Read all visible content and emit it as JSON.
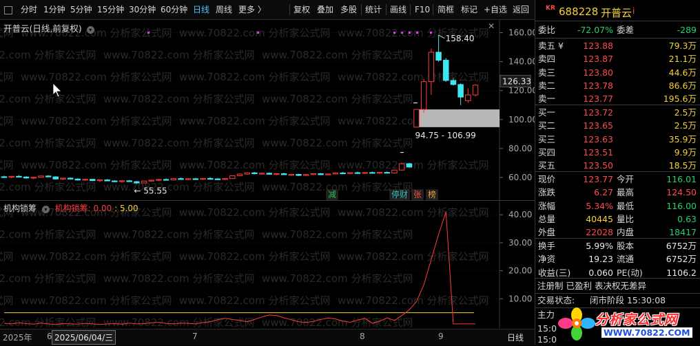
{
  "toolbar": {
    "periods": [
      "分时",
      "1分钟",
      "5分钟",
      "15分钟",
      "30分钟",
      "60分钟",
      "日线",
      "周线",
      "更多 〉"
    ],
    "active_period": "日线",
    "actions": [
      "复权",
      "叠加",
      "多股",
      "统计",
      "画线",
      "F10",
      "简框",
      "标记",
      "+自选",
      "返回"
    ]
  },
  "chart": {
    "title": "开普云(日线,前复权)",
    "watermark": "www.70822.com 分析家公式网",
    "y_ticks": [
      "160.00",
      "140.00",
      "120.00",
      "100.00",
      "80.00",
      "60.00"
    ],
    "price_tag": "126.33",
    "high_label": "158.40",
    "low_label": "← 55.55",
    "range_label": "94.75 - 106.99",
    "event_tags": [
      {
        "text": "减",
        "color": "#2dbb55"
      },
      {
        "text": "停财",
        "color": "#36c0c0"
      },
      {
        "text": "张",
        "color": "#ff5050"
      },
      {
        "text": "榜",
        "color": "#e8a23a"
      }
    ]
  },
  "chart_data": {
    "type": "candlestick",
    "ylim": [
      50,
      165
    ],
    "candles_note": "daily OHLC, read from chart",
    "ohlc": [
      [
        60.5,
        61.2,
        59.8,
        60.2
      ],
      [
        60.2,
        61.0,
        59.5,
        60.8
      ],
      [
        60.8,
        61.5,
        60.0,
        60.3
      ],
      [
        60.3,
        60.9,
        59.2,
        59.6
      ],
      [
        59.6,
        60.4,
        58.9,
        60.1
      ],
      [
        60.1,
        61.3,
        59.8,
        61.0
      ],
      [
        61.0,
        61.6,
        60.1,
        60.4
      ],
      [
        60.4,
        60.8,
        58.6,
        58.9
      ],
      [
        58.9,
        59.8,
        58.2,
        59.5
      ],
      [
        59.5,
        60.1,
        58.7,
        58.9
      ],
      [
        58.9,
        59.4,
        57.8,
        58.2
      ],
      [
        58.2,
        59.0,
        57.6,
        58.7
      ],
      [
        58.7,
        59.1,
        57.5,
        57.8
      ],
      [
        57.8,
        58.6,
        56.9,
        58.3
      ],
      [
        58.3,
        58.9,
        57.4,
        57.6
      ],
      [
        57.6,
        58.1,
        56.8,
        57.2
      ],
      [
        57.2,
        58.0,
        56.5,
        57.7
      ],
      [
        57.7,
        58.3,
        56.9,
        57.1
      ],
      [
        57.1,
        57.6,
        55.55,
        56.2
      ],
      [
        56.2,
        57.8,
        55.9,
        57.5
      ],
      [
        57.5,
        58.4,
        56.9,
        58.1
      ],
      [
        58.1,
        59.0,
        57.5,
        58.6
      ],
      [
        58.6,
        59.3,
        58.0,
        58.3
      ],
      [
        58.3,
        59.6,
        58.0,
        59.2
      ],
      [
        59.2,
        60.0,
        58.5,
        58.8
      ],
      [
        58.8,
        59.4,
        58.1,
        59.1
      ],
      [
        59.1,
        59.7,
        58.4,
        58.7
      ],
      [
        58.7,
        59.5,
        58.2,
        59.3
      ],
      [
        59.3,
        60.2,
        58.9,
        59.0
      ],
      [
        59.0,
        59.6,
        58.3,
        58.6
      ],
      [
        58.6,
        59.5,
        58.1,
        59.2
      ],
      [
        59.2,
        61.5,
        59.0,
        61.2
      ],
      [
        61.2,
        62.8,
        60.8,
        62.3
      ],
      [
        62.3,
        63.6,
        61.9,
        63.2
      ],
      [
        63.2,
        63.8,
        62.1,
        62.6
      ],
      [
        62.6,
        63.4,
        61.8,
        62.9
      ],
      [
        62.9,
        63.5,
        61.9,
        62.2
      ],
      [
        62.2,
        62.9,
        61.5,
        62.6
      ],
      [
        62.6,
        63.2,
        61.7,
        61.9
      ],
      [
        61.9,
        62.5,
        61.1,
        62.1
      ],
      [
        62.1,
        62.6,
        61.0,
        61.4
      ],
      [
        61.4,
        62.3,
        61.0,
        62.0
      ],
      [
        62.0,
        62.9,
        61.6,
        62.6
      ],
      [
        62.6,
        63.1,
        61.7,
        61.9
      ],
      [
        61.9,
        62.7,
        61.5,
        62.4
      ],
      [
        62.4,
        63.5,
        62.0,
        63.1
      ],
      [
        63.1,
        63.8,
        62.4,
        62.8
      ],
      [
        62.8,
        63.5,
        62.2,
        63.3
      ],
      [
        63.3,
        64.0,
        62.6,
        62.9
      ],
      [
        62.9,
        63.6,
        62.3,
        63.4
      ],
      [
        63.4,
        64.1,
        62.7,
        63.0
      ],
      [
        63.0,
        63.8,
        62.5,
        63.5
      ],
      [
        63.5,
        64.1,
        62.9,
        63.0
      ],
      [
        63.0,
        65.5,
        62.8,
        65.1
      ],
      [
        65.1,
        70.2,
        64.8,
        69.5
      ],
      [
        69.5,
        70.0,
        66.8,
        67.2
      ],
      [
        94.75,
        106.99,
        94.75,
        106.99
      ],
      [
        106.99,
        128.0,
        104.5,
        126.2
      ],
      [
        126.2,
        149.0,
        117.0,
        146.5
      ],
      [
        146.5,
        158.4,
        140.0,
        141.0
      ],
      [
        141.0,
        142.5,
        126.0,
        127.0
      ],
      [
        127.0,
        128.5,
        123.5,
        124.2
      ],
      [
        124.2,
        125.0,
        110.0,
        115.5
      ],
      [
        113.0,
        121.5,
        111.5,
        117.0
      ],
      [
        117.0,
        124.5,
        115.8,
        123.77
      ]
    ]
  },
  "indicator": {
    "name": "机构锁筹",
    "label": "机构锁筹:",
    "value1": "0.00",
    "sep": ":",
    "value2": "5.00",
    "y_ticks": [
      "40.00",
      "30.00",
      "20.00",
      "10.00"
    ],
    "ylim": [
      0,
      43
    ],
    "threshold": 5.0,
    "values": [
      1.2,
      1.0,
      1.4,
      1.1,
      0.9,
      1.3,
      1.0,
      0.8,
      1.1,
      1.0,
      0.9,
      1.2,
      1.0,
      0.8,
      1.0,
      1.1,
      0.9,
      1.3,
      1.0,
      1.1,
      1.4,
      1.6,
      1.2,
      1.0,
      1.3,
      1.2,
      1.0,
      1.5,
      1.8,
      2.5,
      3.0,
      2.6,
      2.2,
      1.8,
      2.6,
      3.5,
      4.2,
      4.0,
      3.2,
      2.5,
      1.8,
      1.5,
      1.9,
      2.6,
      3.1,
      2.8,
      2.0,
      1.6,
      2.4,
      3.0,
      1.2,
      2.0,
      3.2,
      2.2,
      4.0,
      6.0,
      9.0,
      15.0,
      24.0,
      33.0,
      41.0,
      1.0,
      1.0,
      1.0,
      1.0
    ]
  },
  "timeline": {
    "labels": [
      "2025年",
      "6",
      "2025/06/04/三",
      "7",
      "8",
      "9"
    ],
    "period": "日线"
  },
  "quote": {
    "market_badge": "KR",
    "code": "688228",
    "name": "开普云",
    "info_icon": "i",
    "webi_label": "委比",
    "webi_value": "-72.07%",
    "wecha_label": "委差",
    "wecha_value": "-289",
    "sells": [
      {
        "label": "卖五 ¥",
        "price": "123.88",
        "vol": "79.3万"
      },
      {
        "label": "卖四",
        "price": "123.87",
        "vol": "21.1万"
      },
      {
        "label": "卖三",
        "price": "123.80",
        "vol": "44.6万"
      },
      {
        "label": "卖二",
        "price": "123.78",
        "vol": "86.6万"
      },
      {
        "label": "卖一",
        "price": "123.77",
        "vol": "195.6万"
      }
    ],
    "buys": [
      {
        "label": "买一",
        "price": "123.72",
        "vol": "2.5万"
      },
      {
        "label": "买二",
        "price": "123.65",
        "vol": "2.5万"
      },
      {
        "label": "买三",
        "price": "123.63",
        "vol": "35.9万"
      },
      {
        "label": "买四",
        "price": "123.51",
        "vol": "9.9万"
      },
      {
        "label": "买五",
        "price": "123.50",
        "vol": "18.5万"
      }
    ],
    "stats1": [
      {
        "l1": "现价",
        "v1": "123.77",
        "c1": "red",
        "l2": "今开",
        "v2": "116.01",
        "c2": "green"
      },
      {
        "l1": "涨跌",
        "v1": "6.27",
        "c1": "red",
        "l2": "最高",
        "v2": "124.50",
        "c2": "red"
      },
      {
        "l1": "涨幅",
        "v1": "5.34%",
        "c1": "red",
        "l2": "最低",
        "v2": "116.00",
        "c2": "green"
      },
      {
        "l1": "总量",
        "v1": "40445",
        "c1": "yellow",
        "l2": "量比",
        "v2": "0.63",
        "c2": "green"
      },
      {
        "l1": "外盘",
        "v1": "22028",
        "c1": "red",
        "l2": "内盘",
        "v2": "18417",
        "c2": "green"
      }
    ],
    "stats2": [
      {
        "l1": "换手",
        "v1": "5.99%",
        "l2": "股本",
        "v2": "6752万"
      },
      {
        "l1": "净资",
        "v1": "19.23",
        "l2": "流通",
        "v2": "6752万"
      },
      {
        "l1": "收益(三)",
        "v1": "0.060",
        "l2": "PE(动)",
        "v2": "1106.2"
      }
    ],
    "flags": "注册制 已盈利 表决权无差异",
    "status_label": "交易状态:",
    "status_value": "闭市阶段 15:30:08",
    "zhuli": "主力",
    "time_rows": [
      "15:0",
      "15:0"
    ]
  },
  "logo": {
    "text": "分析家公式网",
    "url_text": "WWW.70822.COM"
  }
}
